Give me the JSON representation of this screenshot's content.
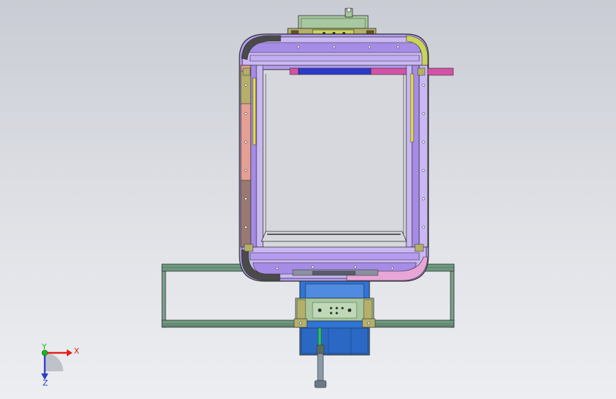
{
  "viewport": {
    "background_top": "#c9ccd4",
    "background_bottom": "#eceef1"
  },
  "triad": {
    "x_label": "X",
    "y_label": "Y",
    "z_label": "Z",
    "x_color": "#e0201a",
    "y_color": "#1db31d",
    "z_color": "#2a3ec8"
  },
  "palette": {
    "frame_purple": "#b59cf0",
    "frame_lavender": "#c9b8f2",
    "salmon": "#e6a093",
    "olive": "#b4b069",
    "yellow_green": "#c9d45b",
    "magenta": "#d253a6",
    "blue_bar": "#2b3ac9",
    "base_blue": "#2f74d6",
    "plate_green": "#a8c8a0",
    "rail_green": "#6e9a80",
    "pink": "#e8a6d6",
    "outline": "#2b2b2b"
  }
}
